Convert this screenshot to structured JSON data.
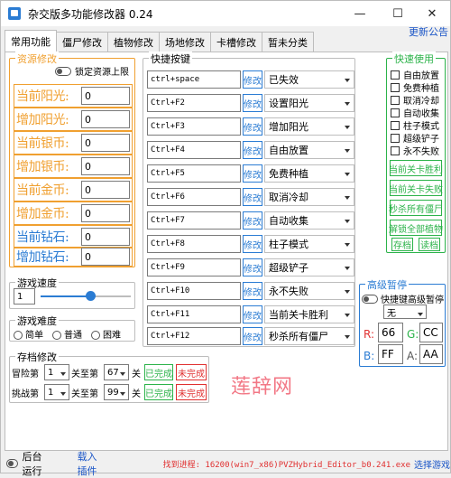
{
  "window": {
    "title": "杂交版多功能修改器  0.24",
    "minimize": "—",
    "maximize": "☐",
    "close": "✕"
  },
  "tabs": [
    "常用功能",
    "僵尸修改",
    "植物修改",
    "场地修改",
    "卡槽修改",
    "暂未分类"
  ],
  "update_link": "更新公告",
  "resources": {
    "group_label": "资源修改",
    "lock_label": "锁定资源上限",
    "rows": [
      {
        "label": "当前阳光:",
        "value": "0"
      },
      {
        "label": "增加阳光:",
        "value": "0"
      },
      {
        "label": "当前银币:",
        "value": "0"
      },
      {
        "label": "增加银币:",
        "value": "0"
      },
      {
        "label": "当前金币:",
        "value": "0"
      },
      {
        "label": "增加金币:",
        "value": "0"
      },
      {
        "label": "当前钻石:",
        "value": "0"
      },
      {
        "label": "增加钻石:",
        "value": "0"
      }
    ]
  },
  "hotkeys": {
    "group_label": "快捷按键",
    "edit_label": "修改",
    "rows": [
      {
        "key": "ctrl+space",
        "action": "已失效"
      },
      {
        "key": "Ctrl+F2",
        "action": "设置阳光"
      },
      {
        "key": "Ctrl+F3",
        "action": "增加阳光"
      },
      {
        "key": "Ctrl+F4",
        "action": "自由放置"
      },
      {
        "key": "Ctrl+F5",
        "action": "免费种植"
      },
      {
        "key": "Ctrl+F6",
        "action": "取消冷却"
      },
      {
        "key": "Ctrl+F7",
        "action": "自动收集"
      },
      {
        "key": "Ctrl+F8",
        "action": "柱子模式"
      },
      {
        "key": "Ctrl+F9",
        "action": "超级铲子"
      },
      {
        "key": "Ctrl+F10",
        "action": "永不失败"
      },
      {
        "key": "Ctrl+F11",
        "action": "当前关卡胜利"
      },
      {
        "key": "Ctrl+F12",
        "action": "秒杀所有僵尸"
      }
    ]
  },
  "quick": {
    "group_label": "快速使用",
    "checks": [
      "自由放置",
      "免费种植",
      "取消冷却",
      "自动收集",
      "柱子模式",
      "超级铲子",
      "永不失败"
    ],
    "buttons": [
      "当前关卡胜利",
      "当前关卡失败",
      "秒杀所有僵尸",
      "解锁全部植物"
    ],
    "save_label": "存档",
    "load_label": "读档"
  },
  "speed": {
    "group_label": "游戏速度",
    "value": "1",
    "slider_fraction": 0.55
  },
  "difficulty": {
    "group_label": "游戏难度",
    "options": [
      "简单",
      "普通",
      "困难"
    ]
  },
  "save_edit": {
    "group_label": "存档修改",
    "rows": [
      {
        "label": "冒险第",
        "a": "1",
        "mid": "关至第",
        "b": "67",
        "end": "关",
        "done": "已完成",
        "undone": "未完成"
      },
      {
        "label": "挑战第",
        "a": "1",
        "mid": "关至第",
        "b": "99",
        "end": "关",
        "done": "已完成",
        "undone": "未完成"
      }
    ]
  },
  "advanced": {
    "group_label": "高级暂停",
    "toggle_label": "快捷键高级暂停",
    "select_value": "无",
    "r_label": "R:",
    "r_value": "66",
    "g_label": "G:",
    "g_value": "CC",
    "b_label": "B:",
    "b_value": "FF",
    "a_label": "A:",
    "a_value": "AA"
  },
  "watermark": "莲辞网",
  "bottom": {
    "background_run": "后台运行",
    "load_plugin": "载入插件",
    "process": "找到进程: 16200(win7_x86)PVZHybrid_Editor_b0.241.exe",
    "choose_game": "选择游戏"
  },
  "colors": {
    "orange": "#f0a030",
    "green": "#2cb34a",
    "blue": "#2b7cd3",
    "red": "#e03030"
  }
}
